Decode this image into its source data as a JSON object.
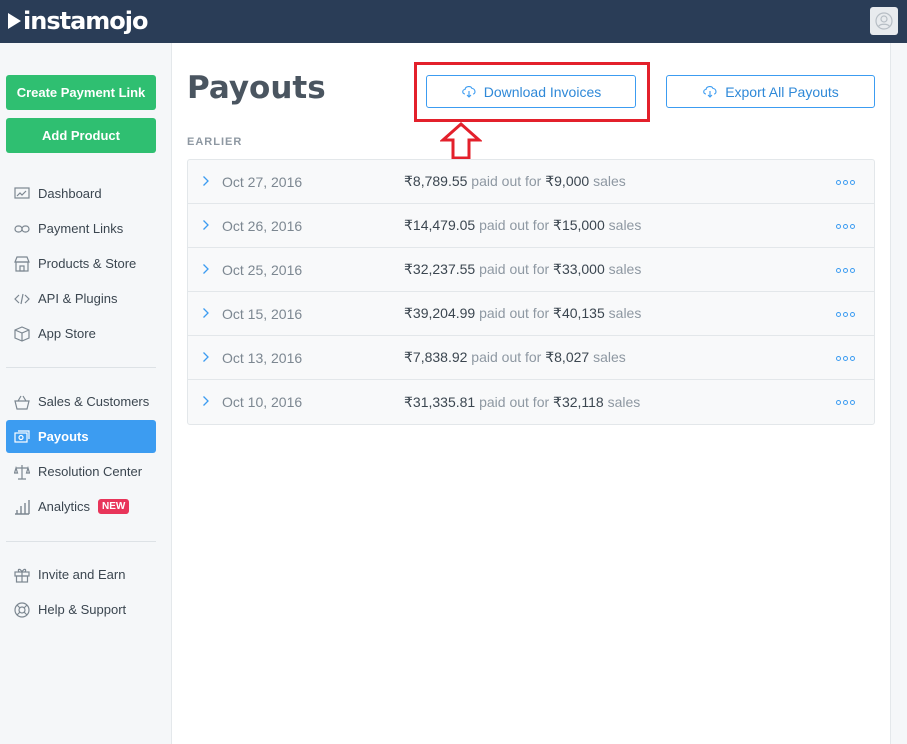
{
  "brand": {
    "name": "instamojo"
  },
  "sidebar": {
    "primary_buttons": [
      {
        "label": "Create Payment Link"
      },
      {
        "label": "Add Product"
      }
    ],
    "groups": [
      [
        {
          "label": "Dashboard",
          "icon": "dashboard-icon"
        },
        {
          "label": "Payment Links",
          "icon": "link-icon"
        },
        {
          "label": "Products & Store",
          "icon": "store-icon"
        },
        {
          "label": "API & Plugins",
          "icon": "code-icon"
        },
        {
          "label": "App Store",
          "icon": "box-icon"
        }
      ],
      [
        {
          "label": "Sales & Customers",
          "icon": "basket-icon"
        },
        {
          "label": "Payouts",
          "icon": "payouts-icon",
          "active": true
        },
        {
          "label": "Resolution Center",
          "icon": "scale-icon"
        },
        {
          "label": "Analytics",
          "icon": "analytics-icon",
          "badge": "NEW"
        }
      ],
      [
        {
          "label": "Invite and Earn",
          "icon": "gift-icon"
        },
        {
          "label": "Help & Support",
          "icon": "lifebuoy-icon"
        }
      ]
    ]
  },
  "main": {
    "title": "Payouts",
    "download_button": "Download Invoices",
    "export_button": "Export All Payouts",
    "section_label": "EARLIER",
    "payouts": [
      {
        "date": "Oct 27, 2016",
        "paid": "₹8,789.55",
        "mid": " paid out for ",
        "sales": "₹9,000",
        "suffix": " sales"
      },
      {
        "date": "Oct 26, 2016",
        "paid": "₹14,479.05",
        "mid": " paid out for ",
        "sales": "₹15,000",
        "suffix": " sales"
      },
      {
        "date": "Oct 25, 2016",
        "paid": "₹32,237.55",
        "mid": " paid out for ",
        "sales": "₹33,000",
        "suffix": " sales"
      },
      {
        "date": "Oct 15, 2016",
        "paid": "₹39,204.99",
        "mid": " paid out for ",
        "sales": "₹40,135",
        "suffix": " sales"
      },
      {
        "date": "Oct 13, 2016",
        "paid": "₹7,838.92",
        "mid": " paid out for ",
        "sales": "₹8,027",
        "suffix": " sales"
      },
      {
        "date": "Oct 10, 2016",
        "paid": "₹31,335.81",
        "mid": " paid out for ",
        "sales": "₹32,118",
        "suffix": " sales"
      }
    ]
  },
  "colors": {
    "topbar": "#2a3d57",
    "green": "#2fbf71",
    "accent": "#3c9cf1",
    "highlight": "#e3202b",
    "badge": "#e8355a"
  }
}
